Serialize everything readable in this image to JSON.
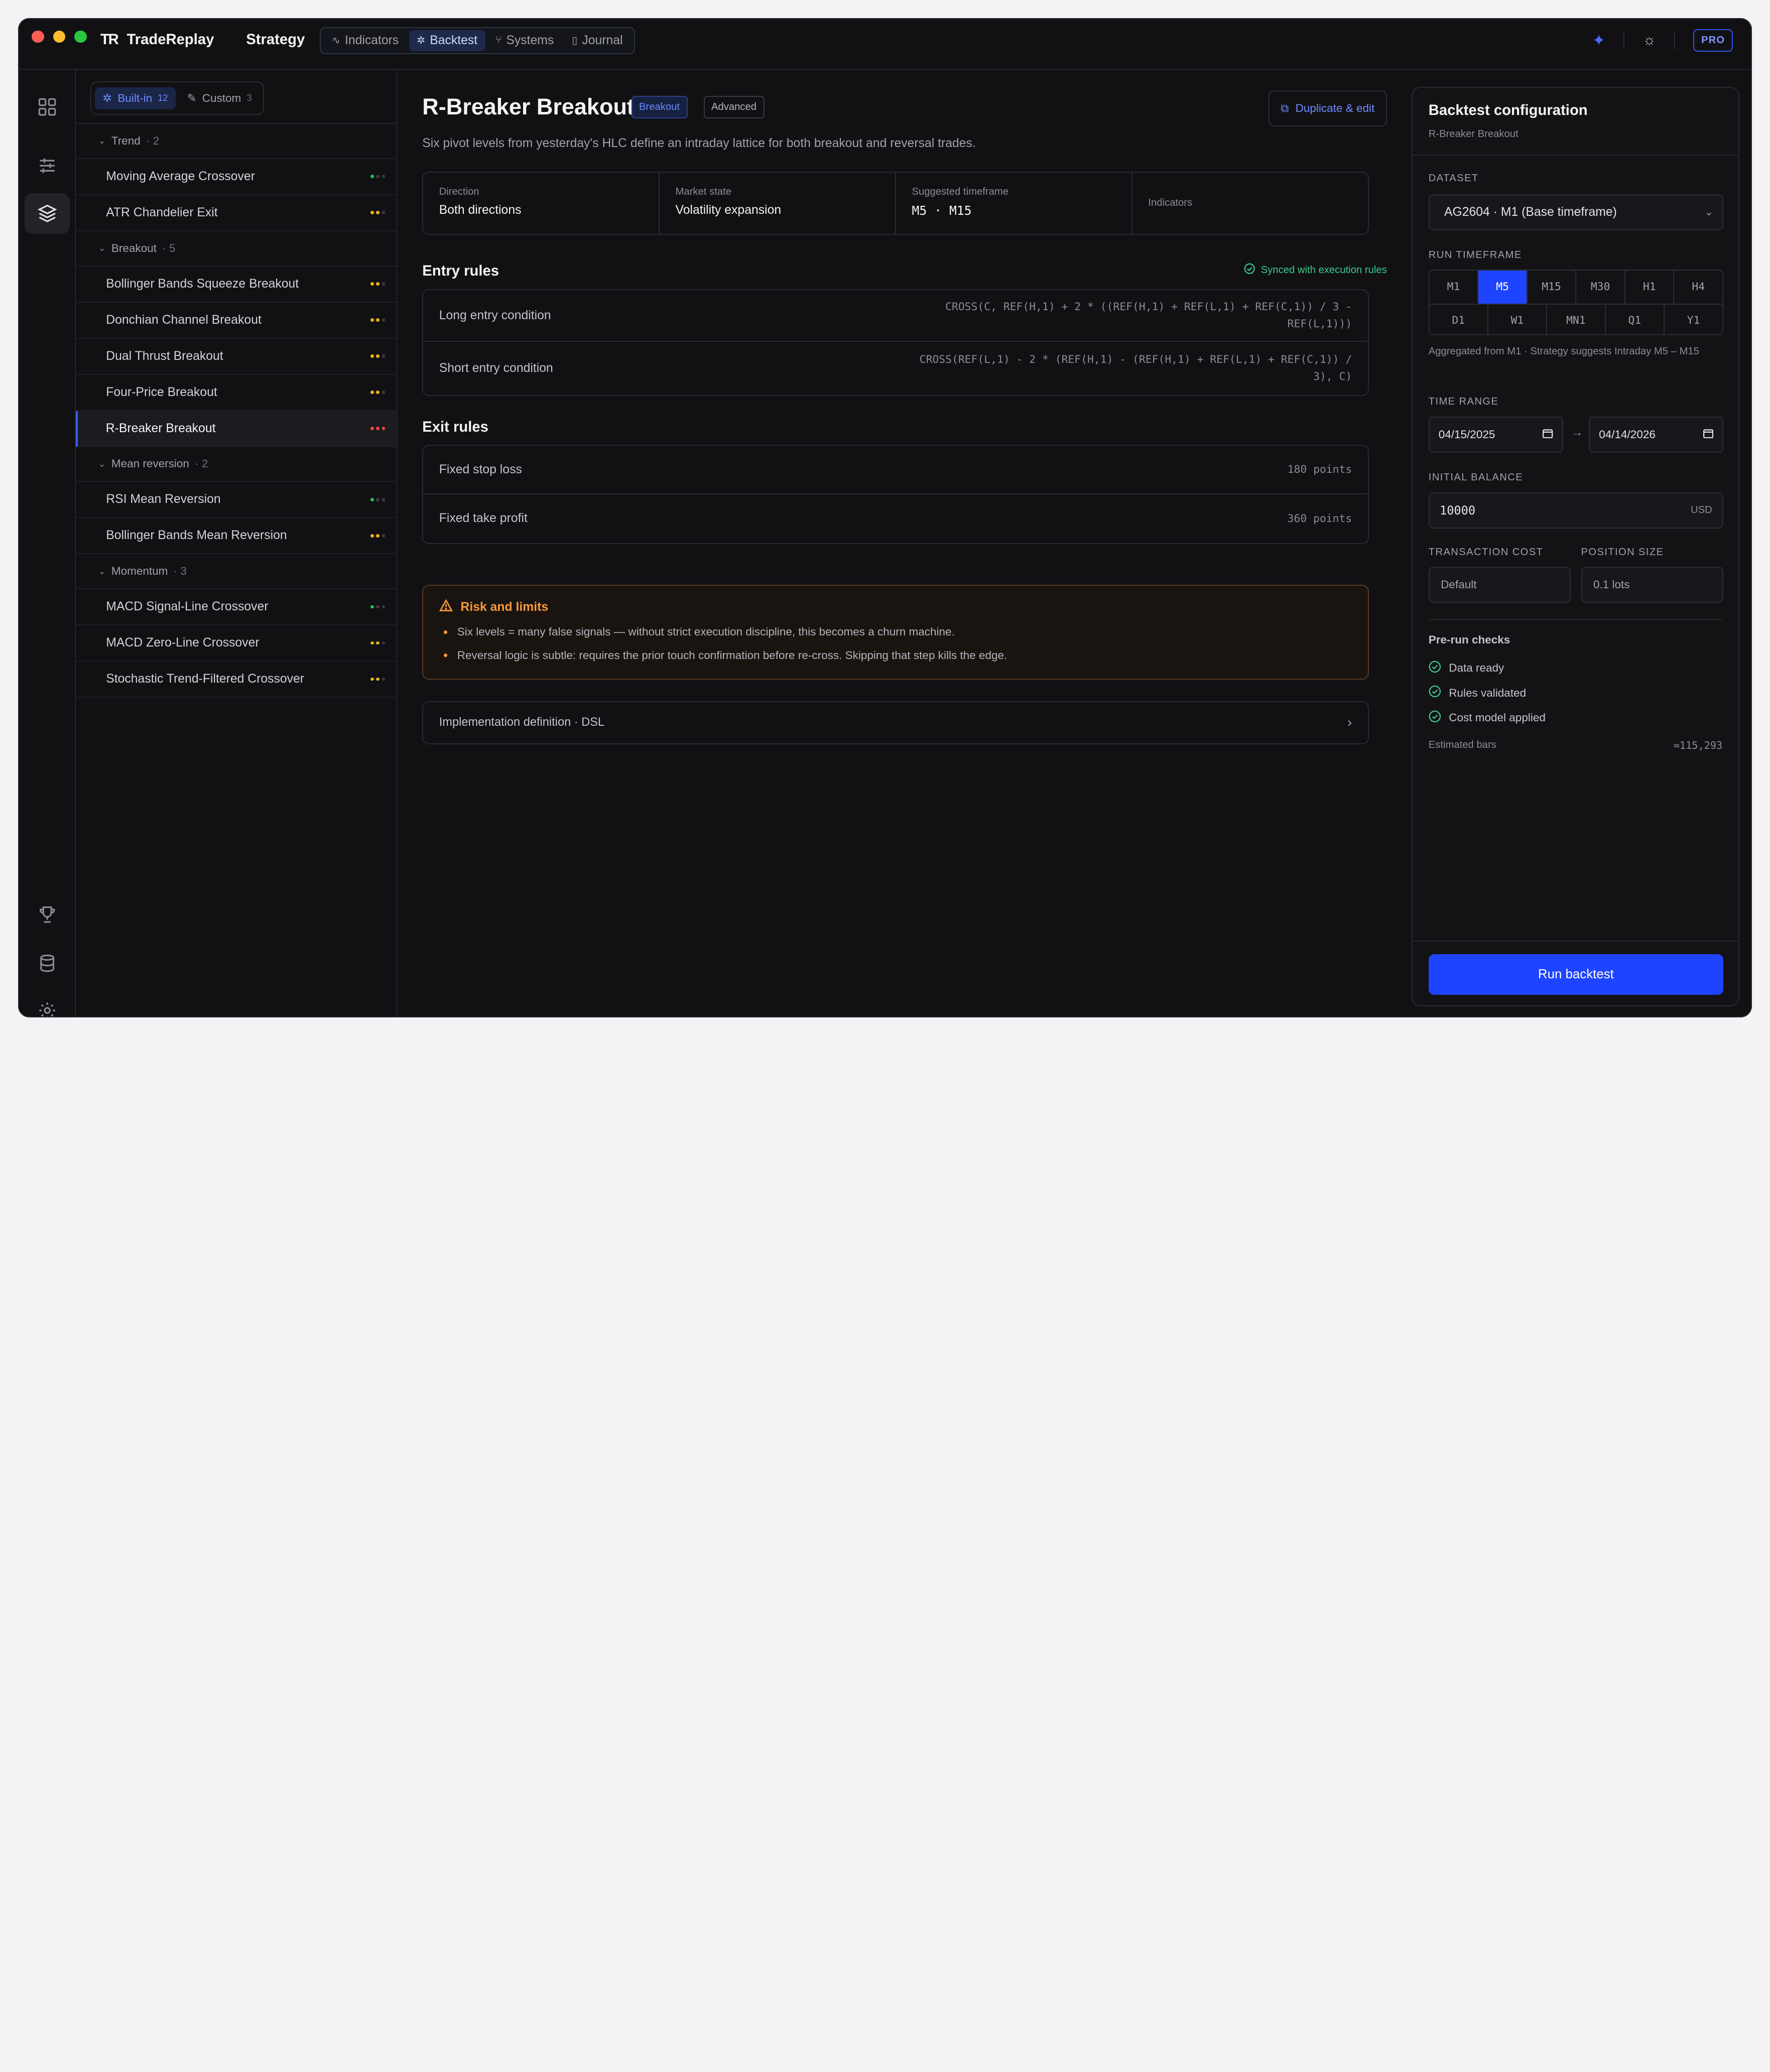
{
  "app": {
    "name": "TradeReplay",
    "logo": "TR",
    "page_title": "Strategy",
    "pro_label": "PRO"
  },
  "nav": {
    "tabs": [
      {
        "label": "Indicators",
        "icon": "activity-icon"
      },
      {
        "label": "Backtest",
        "icon": "sparkle-icon"
      },
      {
        "label": "Systems",
        "icon": "git-branch-icon"
      },
      {
        "label": "Journal",
        "icon": "book-icon"
      }
    ],
    "active": "Backtest"
  },
  "sidebar": {
    "segments": [
      {
        "label": "Built-in",
        "count": "12"
      },
      {
        "label": "Custom",
        "count": "3"
      }
    ],
    "groups": [
      {
        "name": "Trend",
        "count": "· 2",
        "items": [
          {
            "label": "Moving Average Crossover",
            "dots": [
              "#22c55e",
              "#3a3a40",
              "#3a3a40"
            ]
          },
          {
            "label": "ATR Chandelier Exit",
            "dots": [
              "#eab308",
              "#eab308",
              "#3a3a40"
            ]
          }
        ]
      },
      {
        "name": "Breakout",
        "count": "· 5",
        "items": [
          {
            "label": "Bollinger Bands Squeeze Breakout",
            "dots": [
              "#eab308",
              "#eab308",
              "#3a3a40"
            ]
          },
          {
            "label": "Donchian Channel Breakout",
            "dots": [
              "#eab308",
              "#eab308",
              "#3a3a40"
            ]
          },
          {
            "label": "Dual Thrust Breakout",
            "dots": [
              "#eab308",
              "#eab308",
              "#3a3a40"
            ]
          },
          {
            "label": "Four-Price Breakout",
            "dots": [
              "#eab308",
              "#eab308",
              "#3a3a40"
            ]
          },
          {
            "label": "R-Breaker Breakout",
            "dots": [
              "#ef4444",
              "#ef4444",
              "#ef4444"
            ],
            "selected": true
          }
        ]
      },
      {
        "name": "Mean reversion",
        "count": "· 2",
        "items": [
          {
            "label": "RSI Mean Reversion",
            "dots": [
              "#22c55e",
              "#3a3a40",
              "#3a3a40"
            ]
          },
          {
            "label": "Bollinger Bands Mean Reversion",
            "dots": [
              "#eab308",
              "#eab308",
              "#3a3a40"
            ]
          }
        ]
      },
      {
        "name": "Momentum",
        "count": "· 3",
        "items": [
          {
            "label": "MACD Signal-Line Crossover",
            "dots": [
              "#22c55e",
              "#3a3a40",
              "#3a3a40"
            ]
          },
          {
            "label": "MACD Zero-Line Crossover",
            "dots": [
              "#eab308",
              "#eab308",
              "#3a3a40"
            ]
          },
          {
            "label": "Stochastic Trend-Filtered Crossover",
            "dots": [
              "#eab308",
              "#eab308",
              "#3a3a40"
            ]
          }
        ]
      }
    ]
  },
  "strategy": {
    "title": "R-Breaker Breakout",
    "badges": [
      "Breakout",
      "Advanced"
    ],
    "duplicate_label": "Duplicate & edit",
    "description": "Six pivot levels from yesterday's HLC define an intraday lattice for both breakout and reversal trades.",
    "facts": [
      {
        "label": "Direction",
        "value": "Both directions"
      },
      {
        "label": "Market state",
        "value": "Volatility expansion"
      },
      {
        "label": "Suggested timeframe",
        "value": "M5 · M15"
      },
      {
        "label": "Indicators",
        "value": ""
      }
    ],
    "entry_title": "Entry rules",
    "synced_label": "Synced with execution rules",
    "entry_rules": [
      {
        "label": "Long entry condition",
        "value": "CROSS(C, REF(H,1) + 2 * ((REF(H,1) + REF(L,1) + REF(C,1)) / 3 - REF(L,1)))"
      },
      {
        "label": "Short entry condition",
        "value": "CROSS(REF(L,1) - 2 * (REF(H,1) - (REF(H,1) + REF(L,1) + REF(C,1)) / 3), C)"
      }
    ],
    "exit_title": "Exit rules",
    "exit_rules": [
      {
        "label": "Fixed stop loss",
        "value": "180 points"
      },
      {
        "label": "Fixed take profit",
        "value": "360 points"
      }
    ],
    "risk": {
      "title": "Risk and limits",
      "bullets": [
        "Six levels = many false signals — without strict execution discipline, this becomes a churn machine.",
        "Reversal logic is subtle: requires the prior touch confirmation before re-cross. Skipping that step kills the edge."
      ]
    },
    "implementation_label": "Implementation definition · DSL"
  },
  "config": {
    "title": "Backtest configuration",
    "subtitle": "R-Breaker Breakout",
    "dataset_label": "DATASET",
    "dataset_value": "AG2604 · M1 (Base timeframe)",
    "run_tf_label": "RUN TIMEFRAME",
    "tf_row1": [
      "M1",
      "M5",
      "M15",
      "M30",
      "H1",
      "H4"
    ],
    "tf_row2": [
      "D1",
      "W1",
      "MN1",
      "Q1",
      "Y1"
    ],
    "tf_active": "M5",
    "aggregated_note": "Aggregated from M1 · Strategy suggests Intraday M5 – M15",
    "time_range_label": "TIME RANGE",
    "date_from": "04/15/2025",
    "date_to": "04/14/2026",
    "initial_balance_label": "INITIAL BALANCE",
    "initial_balance": "10000",
    "currency": "USD",
    "transaction_cost_label": "TRANSACTION COST",
    "transaction_cost": "Default",
    "position_size_label": "POSITION SIZE",
    "position_size": "0.1 lots",
    "checks_title": "Pre-run checks",
    "checks": [
      "Data ready",
      "Rules validated",
      "Cost model applied"
    ],
    "estimated_label": "Estimated bars",
    "estimated_value": "≈115,293",
    "run_label": "Run backtest"
  }
}
